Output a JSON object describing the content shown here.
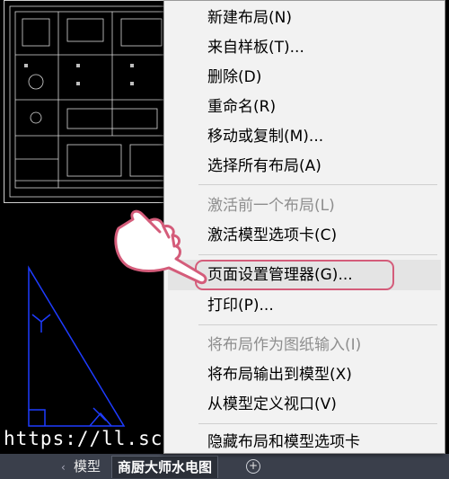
{
  "watermark": "https://ll.sc.cn",
  "tabs": {
    "model": "模型",
    "layout": "商厨大师水电图",
    "add": "+"
  },
  "context_menu": {
    "items": [
      {
        "label": "新建布局(N)",
        "enabled": true
      },
      {
        "label": "来自样板(T)...",
        "enabled": true
      },
      {
        "label": "删除(D)",
        "enabled": true
      },
      {
        "label": "重命名(R)",
        "enabled": true
      },
      {
        "label": "移动或复制(M)...",
        "enabled": true
      },
      {
        "label": "选择所有布局(A)",
        "enabled": true
      },
      {
        "label": "激活前一个布局(L)",
        "enabled": false
      },
      {
        "label": "激活模型选项卡(C)",
        "enabled": true
      },
      {
        "label": "页面设置管理器(G)...",
        "enabled": true,
        "highlighted": true
      },
      {
        "label": "打印(P)...",
        "enabled": true
      },
      {
        "label": "将布局作为图纸输入(I)",
        "enabled": false
      },
      {
        "label": "将布局输出到模型(X)",
        "enabled": true
      },
      {
        "label": "从模型定义视口(V)",
        "enabled": true
      },
      {
        "label": "隐藏布局和模型选项卡",
        "enabled": true
      }
    ]
  },
  "colors": {
    "canvas": "#000000",
    "menu_bg": "#f2f2f2",
    "highlight_border": "#d45c7a",
    "triangle": "#1e3cff",
    "tabbar": "#3a3f4b"
  }
}
